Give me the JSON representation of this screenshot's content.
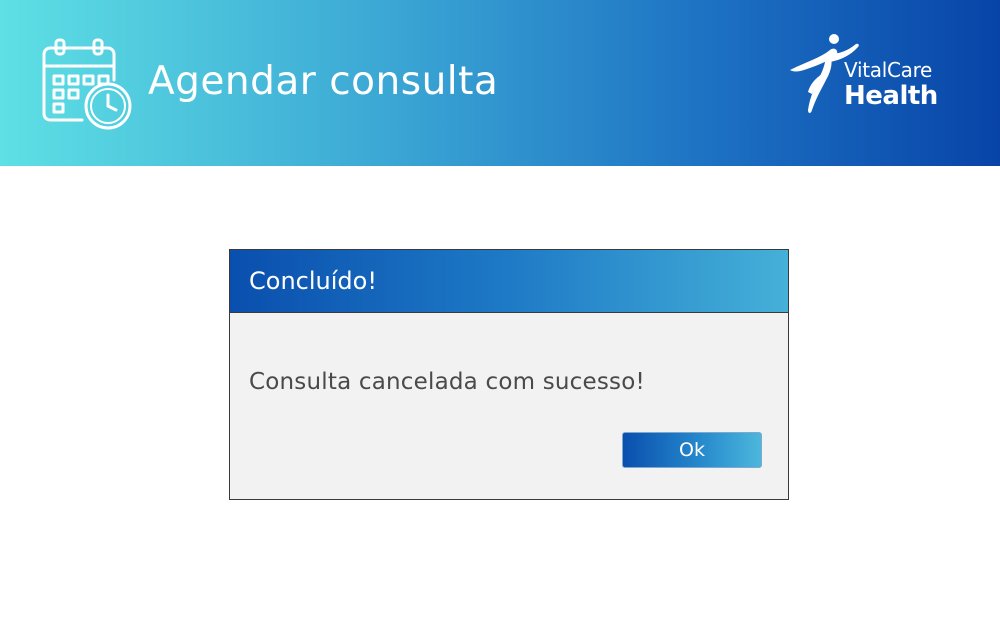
{
  "header": {
    "title": "Agendar consulta",
    "icon": "calendar-clock-icon",
    "gradient": [
      "#5ee0e4",
      "#3aa5d4",
      "#1c70c2",
      "#0844a8"
    ]
  },
  "logo": {
    "brand_line_1": "VitalCare",
    "brand_line_2": "Health",
    "icon": "running-figure-icon"
  },
  "dialog": {
    "title": "Concluído!",
    "message": "Consulta cancelada com sucesso!",
    "ok_label": "Ok",
    "titlebar_colors": [
      "#0a4fae",
      "#1e7ac6",
      "#45b0d8"
    ],
    "body_background": "#f2f2f2",
    "message_color": "#4a4a4a"
  }
}
